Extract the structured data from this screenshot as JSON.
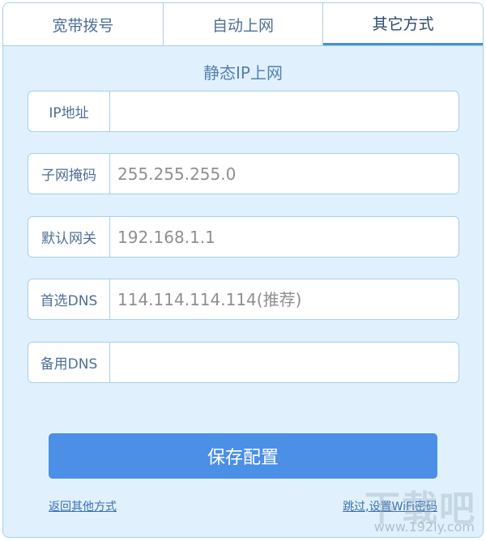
{
  "tabs": [
    {
      "label": "宽带拨号",
      "active": false
    },
    {
      "label": "自动上网",
      "active": false
    },
    {
      "label": "其它方式",
      "active": true
    }
  ],
  "section_title": "静态IP上网",
  "fields": {
    "ip": {
      "label": "IP地址",
      "value": "",
      "placeholder": ""
    },
    "subnet": {
      "label": "子网掩码",
      "value": "",
      "placeholder": "255.255.255.0"
    },
    "gateway": {
      "label": "默认网关",
      "value": "",
      "placeholder": "192.168.1.1"
    },
    "dns1": {
      "label": "首选DNS",
      "value": "",
      "placeholder": "114.114.114.114(推荐)"
    },
    "dns2": {
      "label": "备用DNS",
      "value": "",
      "placeholder": ""
    }
  },
  "save_label": "保存配置",
  "links": {
    "back": "返回其他方式",
    "skip": "跳过,设置WiFi密码"
  },
  "watermark": {
    "logo_text": "下载吧",
    "url": "www.192ly.com"
  },
  "colors": {
    "accent": "#4b8fe6",
    "panel_bg": "#e0f1fd",
    "border": "#a9cfe8"
  }
}
